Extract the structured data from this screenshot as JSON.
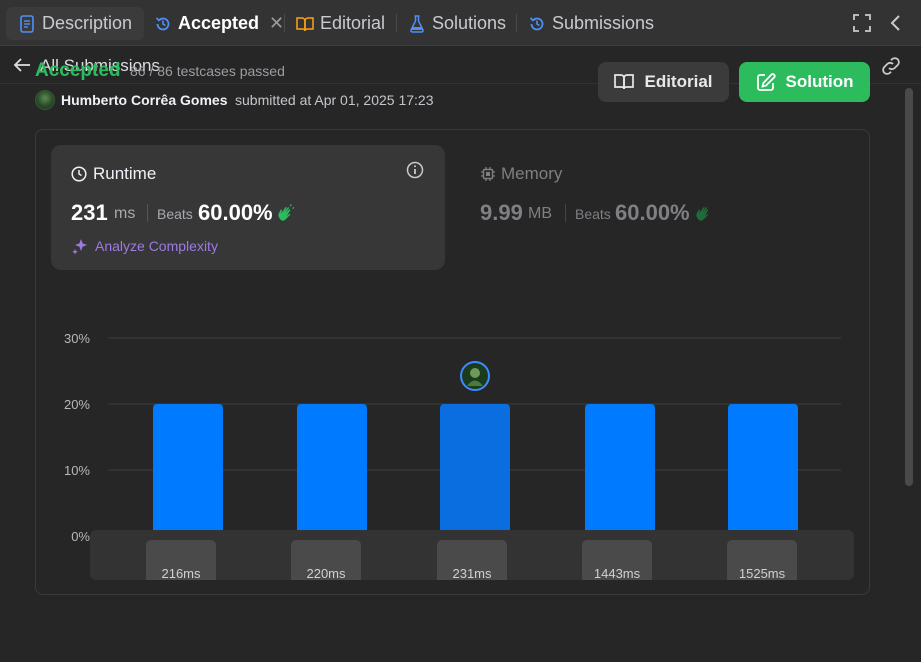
{
  "tabs": {
    "description": "Description",
    "accepted": "Accepted",
    "editorial": "Editorial",
    "solutions": "Solutions",
    "submissions": "Submissions"
  },
  "subheader": {
    "back_label": "All Submissions"
  },
  "submission": {
    "status": "Accepted",
    "testcases": "86 / 86 testcases passed",
    "user": "Humberto Corrêa Gomes",
    "submitted": "submitted at Apr 01, 2025 17:23"
  },
  "buttons": {
    "editorial": "Editorial",
    "solution": "Solution"
  },
  "runtime": {
    "title": "Runtime",
    "value": "231",
    "unit": "ms",
    "beats_label": "Beats",
    "beats": "60.00%",
    "analyze": "Analyze Complexity"
  },
  "memory": {
    "title": "Memory",
    "value": "9.99",
    "unit": "MB",
    "beats_label": "Beats",
    "beats": "60.00%"
  },
  "colors": {
    "accent_green": "#2cbb5d",
    "bar_blue": "#007aff",
    "bar_selected": "#0a6ee0",
    "purple": "#9d7ae6"
  },
  "chart_data": {
    "type": "bar",
    "categories": [
      "216ms",
      "220ms",
      "231ms",
      "1443ms",
      "1525ms"
    ],
    "values": [
      20,
      20,
      20,
      20,
      20
    ],
    "selected_index": 2,
    "ylim": [
      0,
      30
    ],
    "yticks": [
      "0%",
      "10%",
      "20%",
      "30%"
    ],
    "grid": true
  },
  "range_thumbs": [
    "216ms",
    "220ms",
    "231ms",
    "1443ms",
    "1525ms"
  ]
}
